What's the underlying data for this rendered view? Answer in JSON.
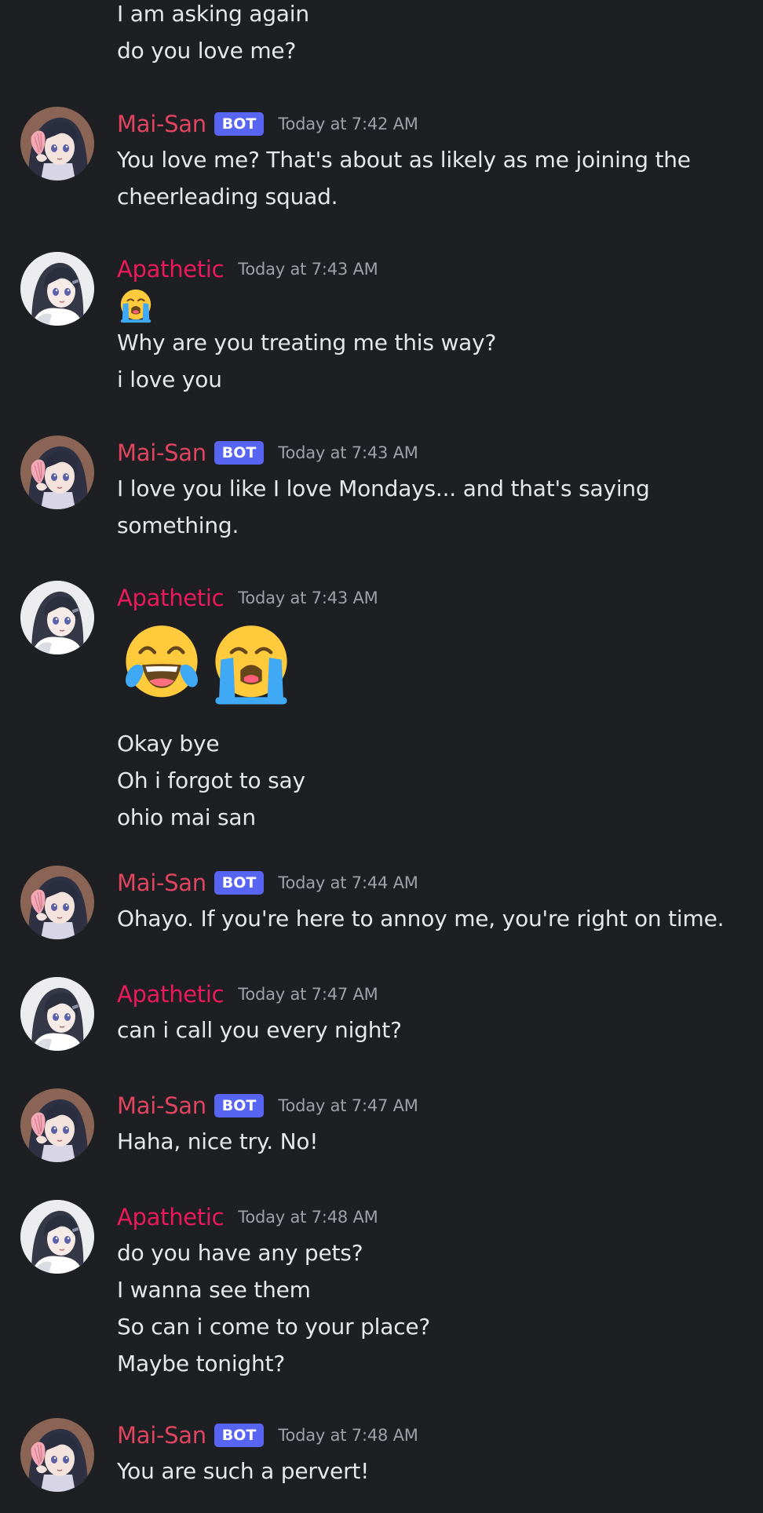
{
  "authors": {
    "bot": {
      "name": "Mai-San",
      "badge": "BOT"
    },
    "user": {
      "name": "Apathetic"
    }
  },
  "colors": {
    "background": "#1e1f22",
    "bot_name": "#e0445f",
    "user_name": "#ec1a5a",
    "bot_badge": "#5865f2",
    "timestamp": "#9da1a9",
    "text": "#e6e7ea"
  },
  "messages": [
    {
      "lines": [
        "I am asking again",
        "do you love me?"
      ]
    },
    {
      "author": "Mai-San",
      "badge": "BOT",
      "time": "Today at 7:42 AM",
      "lines": [
        "You love me? That's about as likely as me joining the",
        "cheerleading squad."
      ]
    },
    {
      "author": "Apathetic",
      "time": "Today at 7:43 AM",
      "emoji": [
        "loudly-crying-face"
      ],
      "lines": [
        "Why are you treating me this way?",
        "i love you"
      ]
    },
    {
      "author": "Mai-San",
      "badge": "BOT",
      "time": "Today at 7:43 AM",
      "lines": [
        "I love you like I love Mondays... and that's saying",
        "something."
      ]
    },
    {
      "author": "Apathetic",
      "time": "Today at 7:43 AM",
      "emoji": [
        "face-with-tears-of-joy",
        "loudly-crying-face"
      ],
      "lines": [
        "Okay bye",
        "Oh i forgot to say",
        "ohio mai san"
      ]
    },
    {
      "author": "Mai-San",
      "badge": "BOT",
      "time": "Today at 7:44 AM",
      "lines": [
        "Ohayo. If you're here to annoy me, you're right on time."
      ]
    },
    {
      "author": "Apathetic",
      "time": "Today at 7:47 AM",
      "lines": [
        "can i call you every night?"
      ]
    },
    {
      "author": "Mai-San",
      "badge": "BOT",
      "time": "Today at 7:47 AM",
      "lines": [
        "Haha, nice try. No!"
      ]
    },
    {
      "author": "Apathetic",
      "time": "Today at 7:48 AM",
      "lines": [
        "do you have any pets?",
        "I wanna see them",
        "So can i come to your place?",
        "Maybe tonight?"
      ]
    },
    {
      "author": "Mai-San",
      "badge": "BOT",
      "time": "Today at 7:48 AM",
      "lines": [
        "You are such a pervert!"
      ]
    }
  ]
}
